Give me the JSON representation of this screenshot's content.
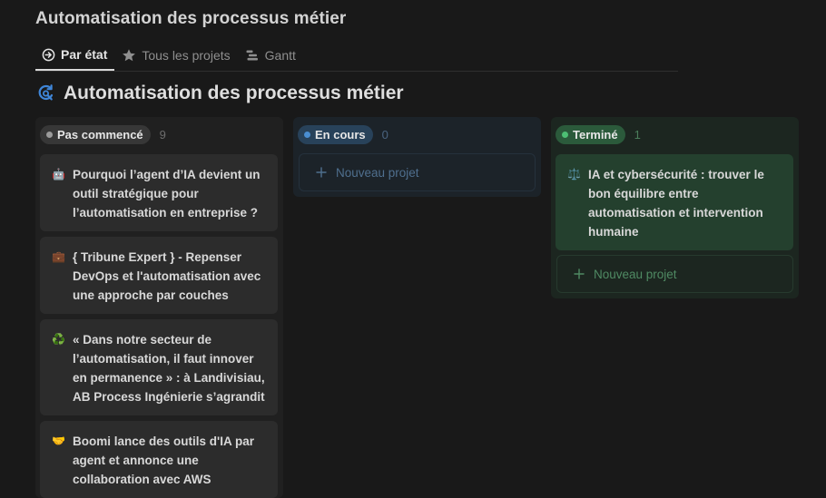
{
  "page": {
    "title": "Automatisation des processus métier"
  },
  "tabs": [
    {
      "label": "Par état",
      "icon": "arrow-circle-icon",
      "active": true
    },
    {
      "label": "Tous les projets",
      "icon": "star-icon",
      "active": false
    },
    {
      "label": "Gantt",
      "icon": "gantt-icon",
      "active": false
    }
  ],
  "board": {
    "title": "Automatisation des processus métier",
    "icon": "refresh-search-icon"
  },
  "columns": [
    {
      "status": "Pas commencé",
      "count": "9",
      "color": "#9b9b9b",
      "cards": [
        {
          "emoji": "🤖",
          "title": "Pourquoi l’agent d’IA devient un outil stratégique pour l’automatisation en entreprise ?"
        },
        {
          "emoji": "💼",
          "title": "{ Tribune Expert } - Repenser DevOps et l'automatisation avec une approche par couches"
        },
        {
          "emoji": "♻️",
          "title": "« Dans notre secteur de l’automatisation, il faut innover en permanence » : à Landivisiau, AB Process Ingénierie s’agrandit"
        },
        {
          "emoji": "🤝",
          "title": "Boomi lance des outils d'IA par agent et annonce une collaboration avec AWS"
        }
      ]
    },
    {
      "status": "En cours",
      "count": "0",
      "color": "#4a8ed1",
      "new_label": "Nouveau projet"
    },
    {
      "status": "Terminé",
      "count": "1",
      "color": "#4dbf74",
      "cards": [
        {
          "emoji": "⚖️",
          "title": "IA et cybersécurité : trouver le bon équilibre entre automatisation et intervention humaine"
        }
      ],
      "new_label": "Nouveau projet"
    }
  ]
}
